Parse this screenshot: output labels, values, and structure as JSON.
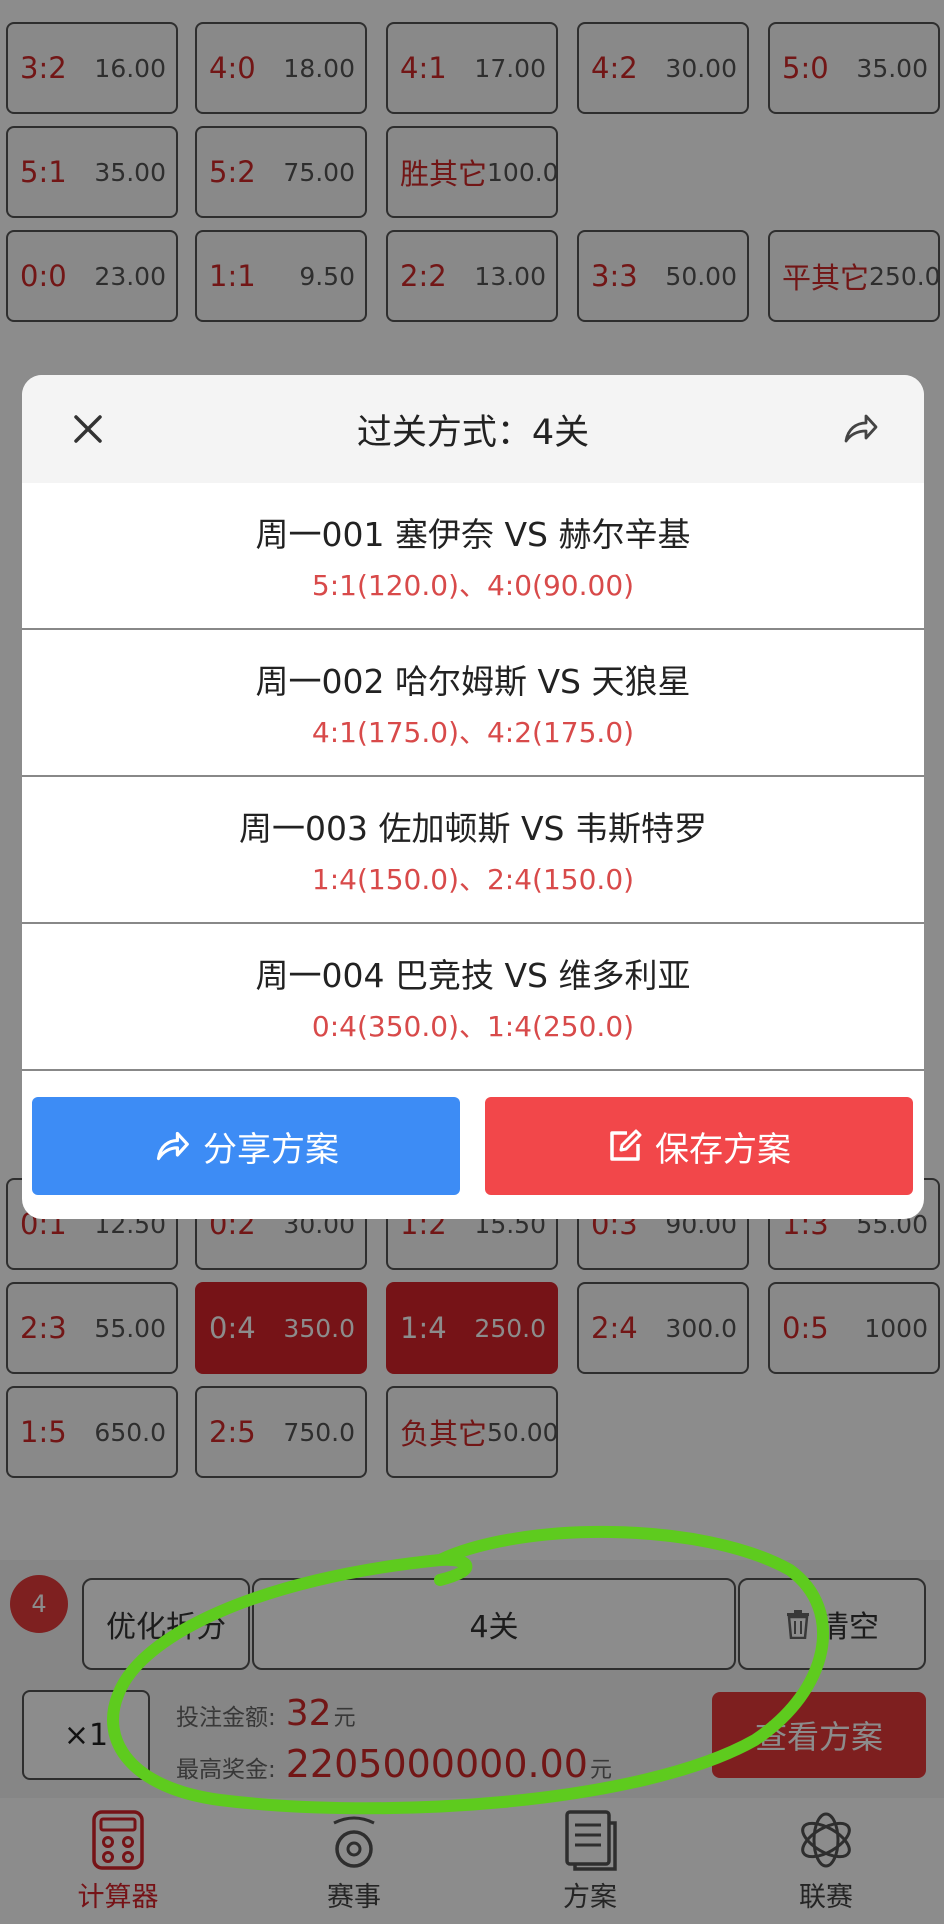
{
  "grid": {
    "rows": [
      [
        {
          "s": "3:2",
          "o": "16.00"
        },
        {
          "s": "4:0",
          "o": "18.00"
        },
        {
          "s": "4:1",
          "o": "17.00"
        },
        {
          "s": "4:2",
          "o": "30.00"
        },
        {
          "s": "5:0",
          "o": "35.00"
        }
      ],
      [
        {
          "s": "5:1",
          "o": "35.00"
        },
        {
          "s": "5:2",
          "o": "75.00"
        },
        {
          "s": "胜其它",
          "o": "100.0"
        }
      ],
      [
        {
          "s": "0:0",
          "o": "23.00"
        },
        {
          "s": "1:1",
          "o": "9.50"
        },
        {
          "s": "2:2",
          "o": "13.00"
        },
        {
          "s": "3:3",
          "o": "50.00"
        },
        {
          "s": "平其它",
          "o": "250.0"
        }
      ],
      [
        {
          "s": "0:1",
          "o": "12.50"
        },
        {
          "s": "0:2",
          "o": "30.00"
        },
        {
          "s": "1:2",
          "o": "15.50"
        },
        {
          "s": "0:3",
          "o": "90.00"
        },
        {
          "s": "1:3",
          "o": "55.00"
        }
      ],
      [
        {
          "s": "2:3",
          "o": "55.00"
        },
        {
          "s": "0:4",
          "o": "350.0",
          "sel": true
        },
        {
          "s": "1:4",
          "o": "250.0",
          "sel": true
        },
        {
          "s": "2:4",
          "o": "300.0"
        },
        {
          "s": "0:5",
          "o": "1000"
        }
      ],
      [
        {
          "s": "1:5",
          "o": "650.0"
        },
        {
          "s": "2:5",
          "o": "750.0"
        },
        {
          "s": "负其它",
          "o": "50.00"
        }
      ]
    ]
  },
  "modal": {
    "title": "过关方式：4关",
    "matches": [
      {
        "title": "周一001 塞伊奈 VS 赫尔辛基",
        "scores": "5:1(120.0)、4:0(90.00)"
      },
      {
        "title": "周一002 哈尔姆斯 VS 天狼星",
        "scores": "4:1(175.0)、4:2(175.0)"
      },
      {
        "title": "周一003 佐加顿斯 VS 韦斯特罗",
        "scores": "1:4(150.0)、2:4(150.0)"
      },
      {
        "title": "周一004 巴竞技 VS 维多利亚",
        "scores": "0:4(350.0)、1:4(250.0)"
      }
    ],
    "share_label": "分享方案",
    "save_label": "保存方案"
  },
  "bottom": {
    "badge": "4",
    "optimize_label": "优化折分",
    "pass_label": "4关",
    "clear_label": "清空",
    "multiplier": "×1",
    "bet_label": "投注金额:",
    "bet_value": "32",
    "unit": "元",
    "prize_label": "最高奖金:",
    "prize_value": "2205000000.00",
    "view_label": "查看方案"
  },
  "tabs": [
    {
      "label": "计算器",
      "icon": "calculator-icon",
      "active": true
    },
    {
      "label": "赛事",
      "icon": "whistle-icon",
      "active": false
    },
    {
      "label": "方案",
      "icon": "document-icon",
      "active": false
    },
    {
      "label": "联赛",
      "icon": "knot-icon",
      "active": false
    }
  ],
  "colors": {
    "accent_red": "#d8242a",
    "share_blue": "#3d8cf5",
    "save_red": "#f2474a",
    "annotation_green": "#5ecb1e"
  }
}
